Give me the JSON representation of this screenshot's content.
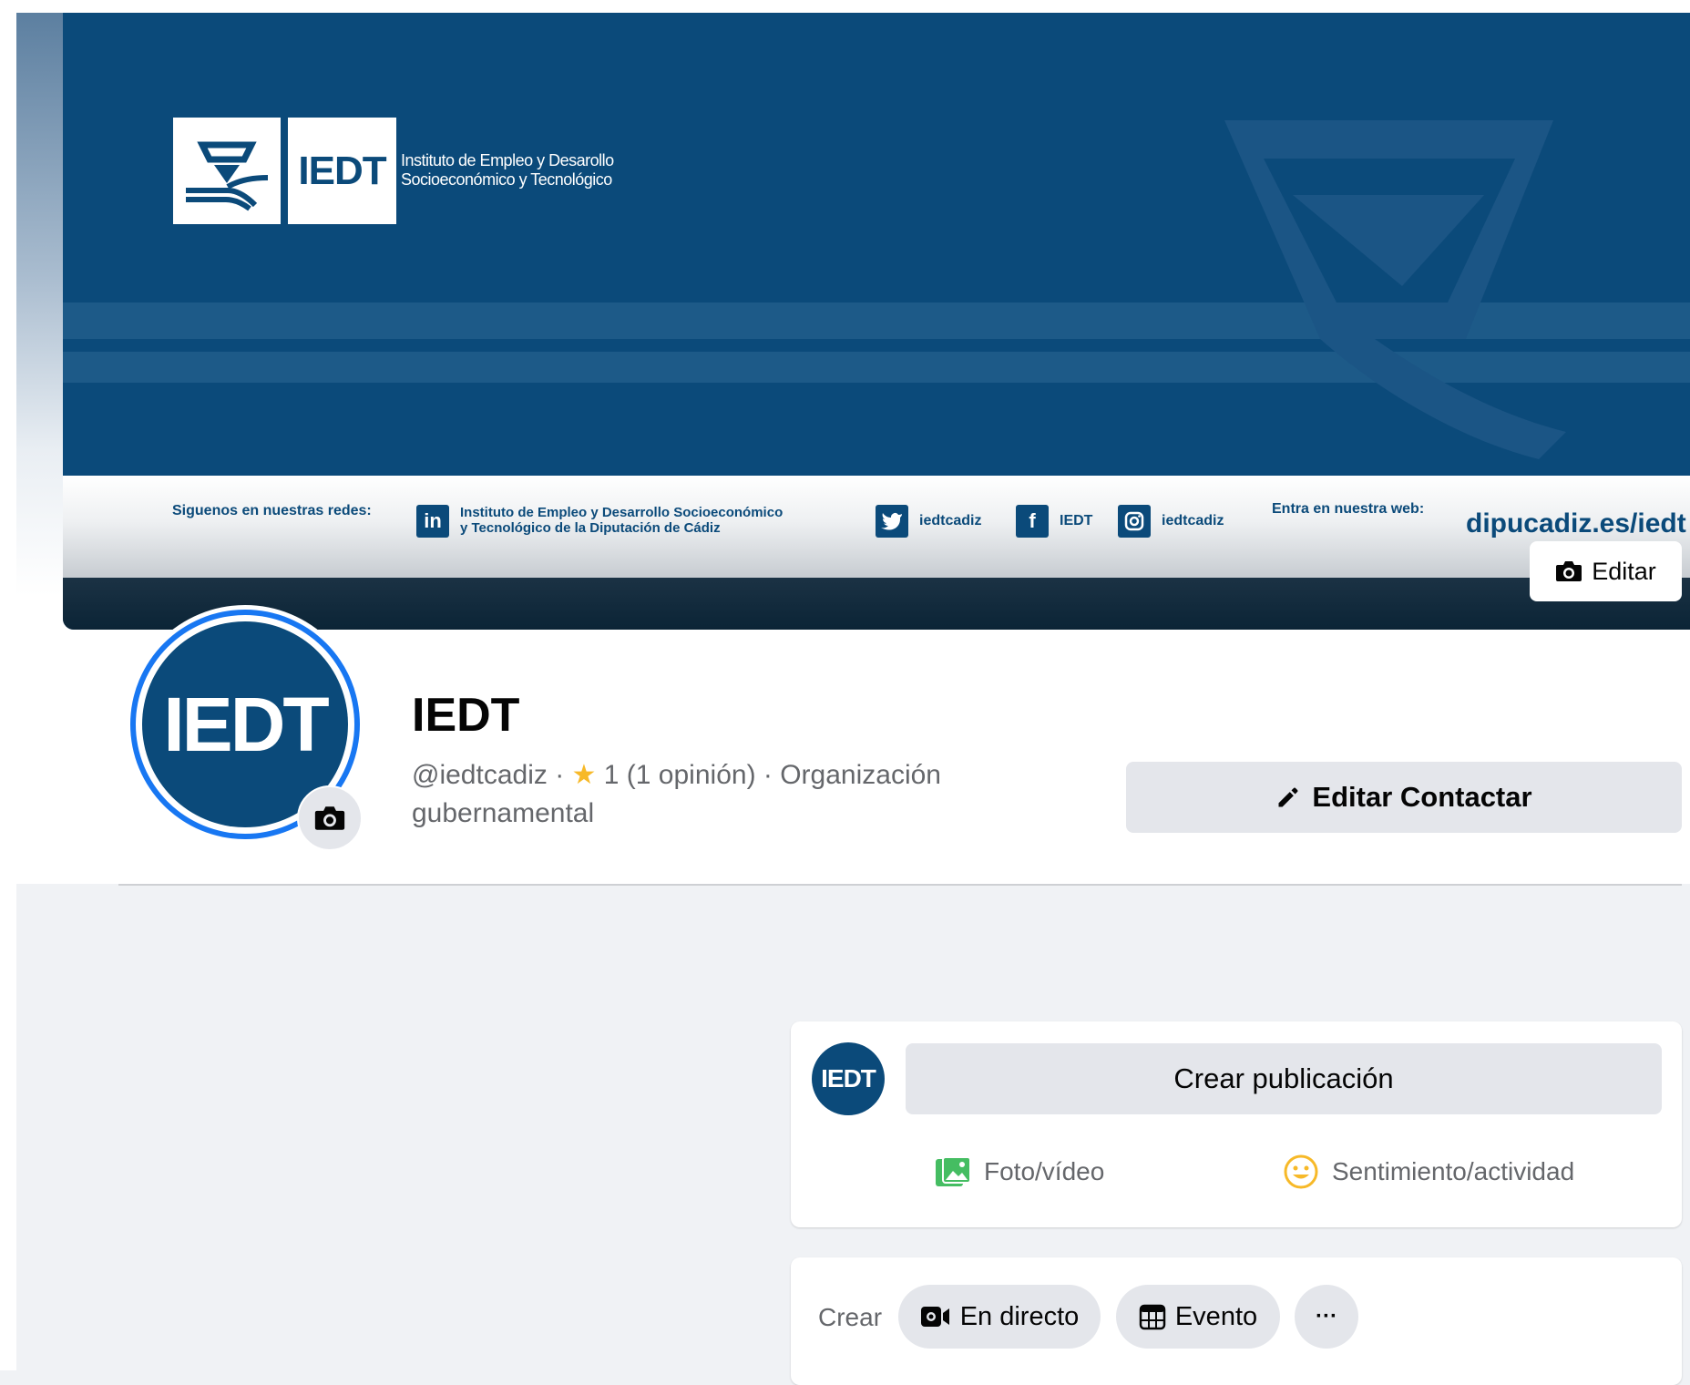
{
  "cover": {
    "logo_text": "IEDT",
    "logo_caption_line1": "Instituto de Empleo y Desarollo",
    "logo_caption_line2": "Socioeconómico y Tecnológico",
    "follow_label": "Siguenos en nuestras redes:",
    "linkedin_line1": "Instituto de Empleo y Desarrollo Socioeconómico",
    "linkedin_line2": "y Tecnológico de la Diputación de Cádiz",
    "twitter_handle": "iedtcadiz",
    "facebook_handle": "IEDT",
    "instagram_handle": "iedtcadiz",
    "web_label": "Entra en nuestra web:",
    "web_url": "dipucadiz.es/iedt",
    "edit_label": "Editar",
    "brand_color": "#0b4a7a"
  },
  "profile": {
    "avatar_text": "IEDT",
    "name": "IEDT",
    "handle": "@iedtcadiz · ",
    "rating": "1 (1 opinión) · Organización",
    "category_line2": "gubernamental",
    "edit_contact_label": "Editar Contactar"
  },
  "composer": {
    "avatar_text": "IEDT",
    "placeholder": "Crear publicación",
    "photo_label": "Foto/vídeo",
    "feeling_label": "Sentimiento/actividad"
  },
  "create": {
    "label": "Crear",
    "live_label": "En directo",
    "event_label": "Evento",
    "more_label": "···"
  }
}
